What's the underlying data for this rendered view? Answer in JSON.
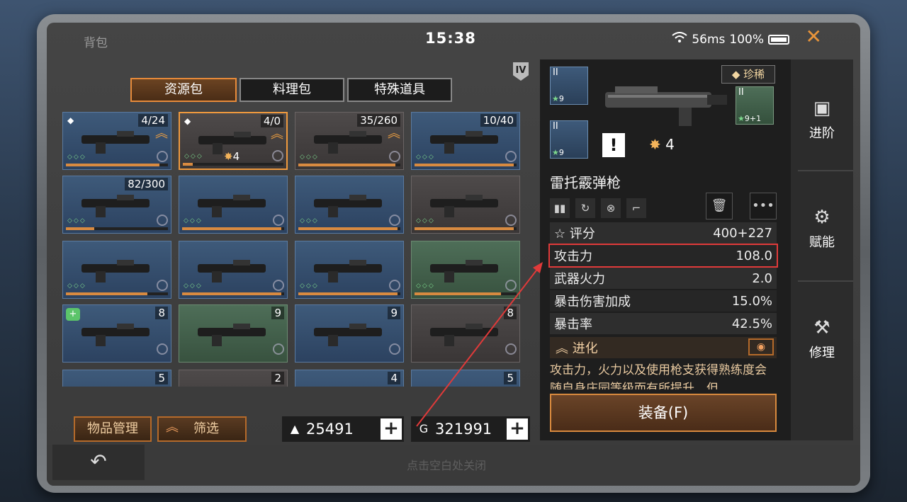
{
  "status_bar": {
    "title": "背包",
    "time": "15:38",
    "ping": "56ms",
    "battery": "100%",
    "close_symbol": "✕"
  },
  "tabs": [
    "资源包",
    "料理包",
    "特殊道具"
  ],
  "rank_badge": "IV",
  "grid_items": [
    {
      "name": "grenade-launcher",
      "count": "4/24",
      "theme": "blue",
      "gem": true,
      "upgrade": true,
      "progress": 0.92
    },
    {
      "name": "shotgun",
      "count": "4/0",
      "theme": "grey",
      "gem": true,
      "upgrade": true,
      "selected": true,
      "star": "4",
      "progress": 0.1
    },
    {
      "name": "assault-rifle",
      "count": "35/260",
      "theme": "grey",
      "upgrade": true,
      "progress": 0.95
    },
    {
      "name": "sniper-rifle",
      "count": "10/40",
      "theme": "blue",
      "progress": 0.97
    },
    {
      "name": "heavy-gun",
      "count": "82/300",
      "theme": "blue",
      "progress": 0.28
    },
    {
      "name": "pickaxe",
      "count": "",
      "theme": "blue",
      "progress": 0.97
    },
    {
      "name": "pickaxe",
      "count": "",
      "theme": "blue",
      "progress": 0.97
    },
    {
      "name": "spiked-bat",
      "count": "",
      "theme": "grey",
      "progress": 0.97
    },
    {
      "name": "jet-ski",
      "count": "",
      "theme": "blue",
      "progress": 0.8
    },
    {
      "name": "armor-vest",
      "count": "",
      "theme": "blue",
      "progress": 0.97
    },
    {
      "name": "supply-crate",
      "count": "",
      "theme": "blue",
      "progress": 0.97
    },
    {
      "name": "lantern-post",
      "count": "",
      "theme": "green",
      "progress": 0.85
    },
    {
      "name": "syringe",
      "count": "8",
      "theme": "blue",
      "heart": true
    },
    {
      "name": "fishing-lure",
      "count": "9",
      "theme": "green"
    },
    {
      "name": "mushrooms",
      "count": "9",
      "theme": "blue"
    },
    {
      "name": "catfish",
      "count": "8",
      "theme": "grey"
    },
    {
      "name": "fish-a",
      "count": "5",
      "theme": "blue"
    },
    {
      "name": "fish-b",
      "count": "2",
      "theme": "grey"
    },
    {
      "name": "fish-c",
      "count": "4",
      "theme": "blue"
    },
    {
      "name": "fish-d",
      "count": "5",
      "theme": "blue"
    }
  ],
  "buttons": {
    "item_manage": "物品管理",
    "filter": "筛选",
    "equip": "装备(F)"
  },
  "currency": [
    {
      "value": "25491",
      "icon": "▲"
    },
    {
      "value": "321991",
      "icon": "G"
    }
  ],
  "footer": {
    "hint": "点击空白处关闭",
    "back_symbol": "↶"
  },
  "weapon": {
    "rarity": "珍稀",
    "name": "雷托霰弹枪",
    "star": "4",
    "mods": [
      {
        "tier": "II",
        "level": "9",
        "theme": "blue"
      },
      {
        "tier": "II",
        "level": "9",
        "theme": "blue"
      },
      {
        "tier": "II",
        "level": "9+1",
        "theme": "green"
      }
    ],
    "stats": [
      {
        "label": "评分",
        "value": "400+227"
      },
      {
        "label": "攻击力",
        "value": "108.0"
      },
      {
        "label": "武器火力",
        "value": "2.0"
      },
      {
        "label": "暴击伤害加成",
        "value": "15.0%"
      },
      {
        "label": "暴击率",
        "value": "42.5%"
      }
    ],
    "evolution_title": "进化",
    "description": "攻击力，火力以及使用枪支获得熟练度会随自身庄园等级而有所提升，但"
  },
  "side_nav": [
    "进阶",
    "赋能",
    "修理"
  ],
  "colors": {
    "accent": "#e8943a",
    "highlight": "#e03a3a"
  }
}
